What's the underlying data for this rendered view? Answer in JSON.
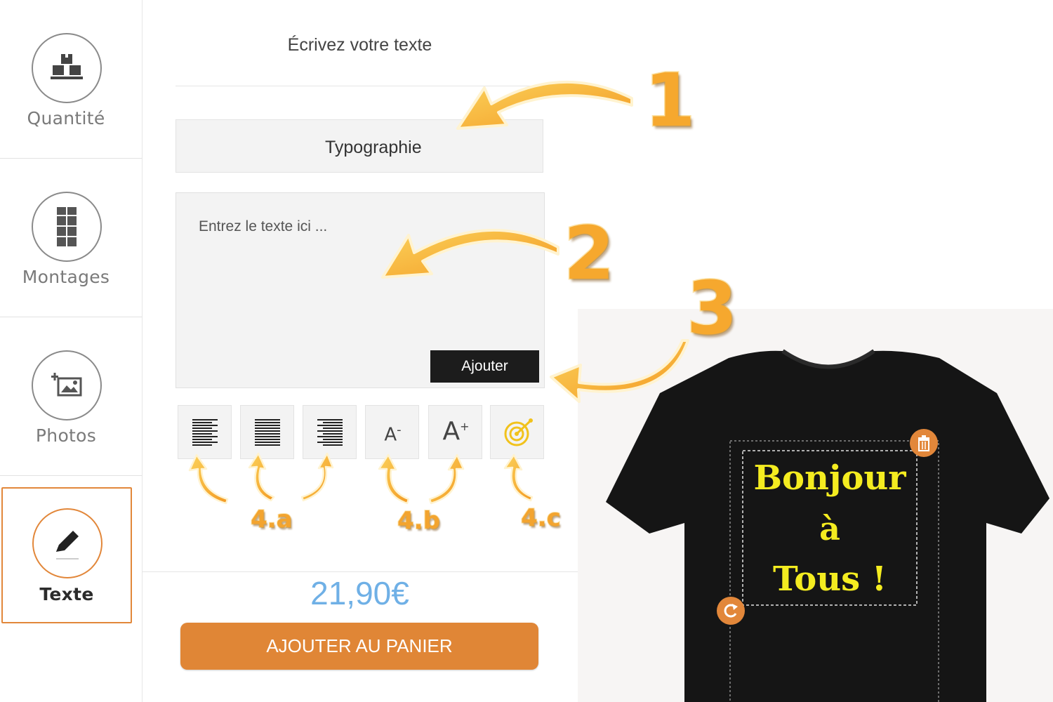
{
  "sidebar": {
    "items": [
      {
        "label": "Quantité",
        "icon": "boxes-icon",
        "active": false
      },
      {
        "label": "Montages",
        "icon": "layout-grid-icon",
        "active": false
      },
      {
        "label": "Photos",
        "icon": "add-photo-icon",
        "active": false
      },
      {
        "label": "Texte",
        "icon": "pencil-icon",
        "active": true
      }
    ]
  },
  "panel": {
    "title": "Écrivez votre texte",
    "typography_label": "Typographie",
    "text_placeholder": "Entrez le texte ici ...",
    "add_label": "Ajouter",
    "tools": [
      {
        "name": "align-left",
        "icon": "align-left-icon"
      },
      {
        "name": "align-center",
        "icon": "align-center-icon"
      },
      {
        "name": "align-right",
        "icon": "align-right-icon"
      },
      {
        "name": "font-decrease",
        "icon": "font-size-decrease-icon",
        "glyph": "A",
        "sup": "-"
      },
      {
        "name": "font-increase",
        "icon": "font-size-increase-icon",
        "glyph": "A",
        "sup": "+"
      },
      {
        "name": "color",
        "icon": "color-palette-icon"
      }
    ],
    "price": "21,90€",
    "cart_label": "AJOUTER AU PANIER"
  },
  "annotations": {
    "step1": "1",
    "step2": "2",
    "step3": "3",
    "step4a": "4.a",
    "step4b": "4.b",
    "step4c": "4.c"
  },
  "preview": {
    "lines": [
      "Bonjour",
      "à",
      "Tous !"
    ],
    "delete_icon": "trash-icon",
    "rotate_icon": "rotate-icon"
  },
  "colors": {
    "accent": "#e2873a",
    "price": "#6fb0e6",
    "annotation": "#f6a82e",
    "shirt_text": "#f4ec20",
    "shirt": "#151515"
  }
}
